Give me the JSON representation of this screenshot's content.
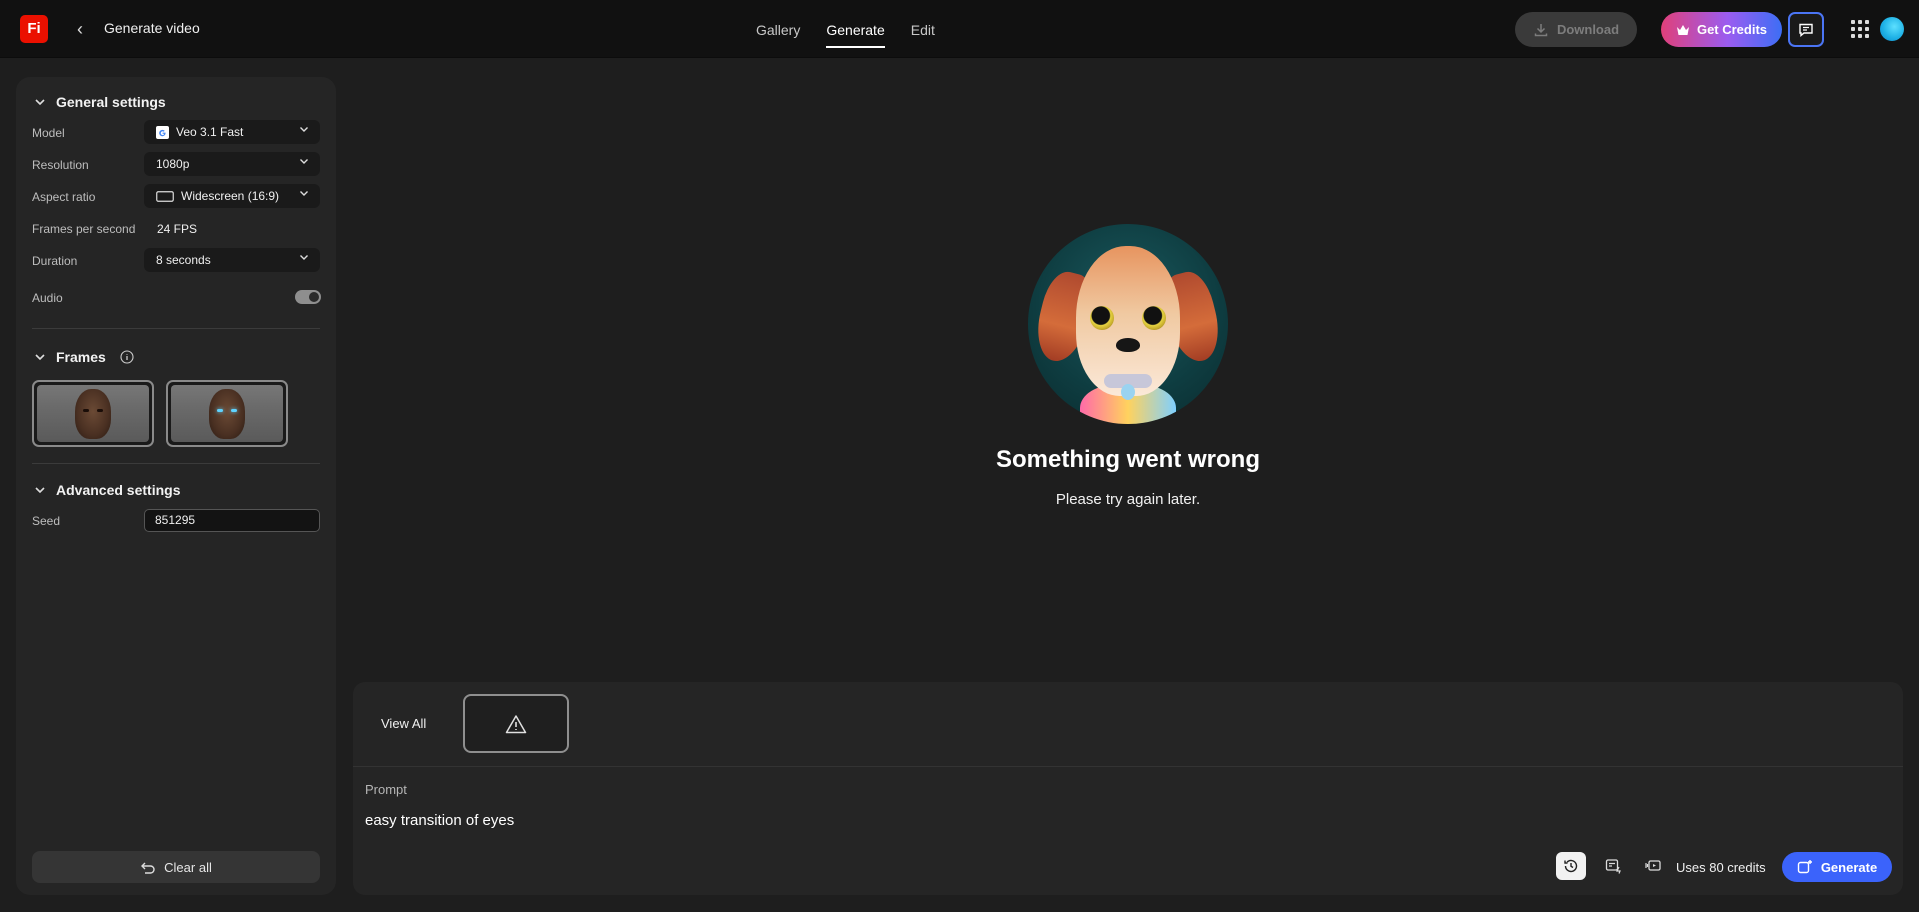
{
  "app": {
    "logo_text": "Fi",
    "page_title": "Generate video"
  },
  "nav": {
    "tabs": [
      {
        "label": "Gallery"
      },
      {
        "label": "Generate"
      },
      {
        "label": "Edit"
      }
    ],
    "active": "Generate"
  },
  "header": {
    "download_label": "Download",
    "credits_label": "Get Credits"
  },
  "sidebar": {
    "general": {
      "title": "General settings",
      "model_label": "Model",
      "model_value": "Veo 3.1 Fast",
      "resolution_label": "Resolution",
      "resolution_value": "1080p",
      "aspect_label": "Aspect ratio",
      "aspect_value": "Widescreen (16:9)",
      "fps_label": "Frames per second",
      "fps_value": "24 FPS",
      "duration_label": "Duration",
      "duration_value": "8 seconds",
      "audio_label": "Audio",
      "audio_on": true
    },
    "frames": {
      "title": "Frames"
    },
    "advanced": {
      "title": "Advanced settings",
      "seed_label": "Seed",
      "seed_value": "851295"
    },
    "clear_label": "Clear all"
  },
  "main": {
    "error_title": "Something went wrong",
    "error_message": "Please try again later."
  },
  "prompt": {
    "view_all_label": "View All",
    "label": "Prompt",
    "text": "easy transition of eyes",
    "credits_text": "Uses 80 credits",
    "generate_label": "Generate"
  },
  "colors": {
    "accent_blue": "#3b63fb",
    "brand_red": "#eb1000",
    "background": "#1e1e1e"
  }
}
